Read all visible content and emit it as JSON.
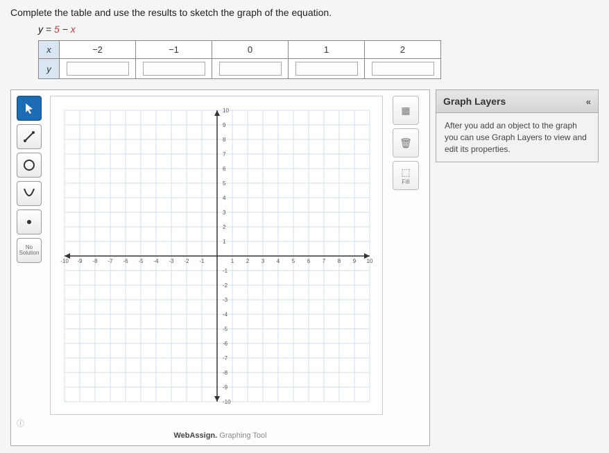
{
  "prompt": "Complete the table and use the results to sketch the graph of the equation.",
  "equation": {
    "lhs": "y",
    "op": "= ",
    "rhs1": "5",
    "mid": " − ",
    "rhs2": "x"
  },
  "table": {
    "x_label": "x",
    "y_label": "y",
    "x_values": [
      "−2",
      "−1",
      "0",
      "1",
      "2"
    ],
    "y_values": [
      "",
      "",
      "",
      "",
      ""
    ]
  },
  "tools": {
    "pointer": "pointer",
    "line": "line",
    "circle": "circle",
    "parabola": "parabola",
    "point": "point",
    "no_solution": "No Solution"
  },
  "right": {
    "colors": "",
    "delete": "",
    "fill_icon": "⬚",
    "fill": "Fill"
  },
  "axis": {
    "xmin": -10,
    "xmax": 10,
    "ymin": -10,
    "ymax": 10,
    "labels_x_neg": [
      "-10",
      "-9",
      "-8",
      "-7",
      "-6",
      "-5",
      "-4",
      "-3",
      "-2",
      "-1"
    ],
    "labels_x_pos": [
      "1",
      "2",
      "3",
      "4",
      "5",
      "6",
      "7",
      "8",
      "9",
      "10"
    ],
    "labels_y_pos": [
      "1",
      "2",
      "3",
      "4",
      "5",
      "6",
      "7",
      "8",
      "9",
      "10"
    ],
    "labels_y_neg": [
      "-1",
      "-2",
      "-3",
      "-4",
      "-5",
      "-6",
      "-7",
      "-8",
      "-9",
      "-10"
    ]
  },
  "brand": {
    "name": "WebAssign.",
    "suffix": " Graphing Tool"
  },
  "layers": {
    "title": "Graph Layers",
    "hint": "After you add an object to the graph you can use Graph Layers to view and edit its properties."
  },
  "helper": "?"
}
